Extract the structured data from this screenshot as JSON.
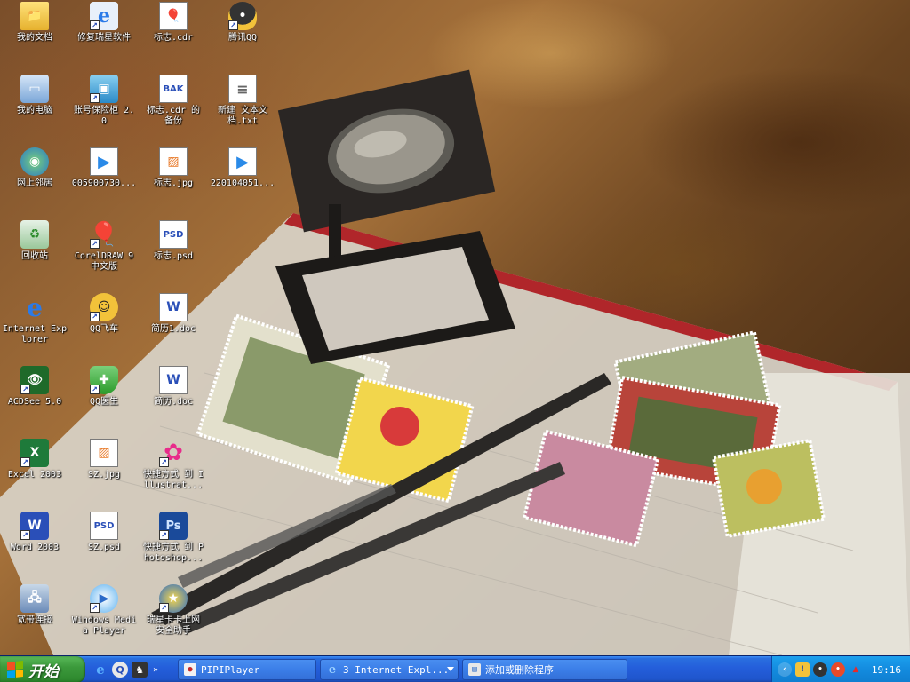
{
  "desktop": {
    "icons": [
      {
        "label": "我的文档",
        "icon": "my-documents-icon"
      },
      {
        "label": "修复瑞星软件",
        "icon": "ie-shortcut-icon"
      },
      {
        "label": "标志.cdr",
        "icon": "coreldraw-file-icon"
      },
      {
        "label": "腾讯QQ",
        "icon": "qq-penguin-icon"
      },
      {
        "label": "我的电脑",
        "icon": "my-computer-icon"
      },
      {
        "label": "账号保险柜 2.0",
        "icon": "account-safe-icon"
      },
      {
        "label": "标志.cdr 的 备份",
        "icon": "backup-file-icon"
      },
      {
        "label": "新建 文本文 档.txt",
        "icon": "text-file-icon"
      },
      {
        "label": "网上邻居",
        "icon": "network-places-icon"
      },
      {
        "label": "005900730...",
        "icon": "media-file-icon"
      },
      {
        "label": "标志.jpg",
        "icon": "jpg-file-icon"
      },
      {
        "label": "220104051...",
        "icon": "media-file-icon"
      },
      {
        "label": "回收站",
        "icon": "recycle-bin-icon"
      },
      {
        "label": "CorelDRAW 9 中文版",
        "icon": "coreldraw-balloon-icon"
      },
      {
        "label": "标志.psd",
        "icon": "psd-file-icon"
      },
      {
        "label": "Internet Explorer",
        "icon": "internet-explorer-icon"
      },
      {
        "label": "QQ飞车",
        "icon": "qq-speed-icon"
      },
      {
        "label": "简历1.doc",
        "icon": "word-doc-icon"
      },
      {
        "label": "ACDSee 5.0",
        "icon": "acdsee-icon"
      },
      {
        "label": "QQ医生",
        "icon": "qq-doctor-icon"
      },
      {
        "label": "简历.doc",
        "icon": "word-doc-icon"
      },
      {
        "label": "Excel 2003",
        "icon": "excel-icon"
      },
      {
        "label": "SZ.jpg",
        "icon": "jpg-file-icon"
      },
      {
        "label": "快捷方式 到 Illustrat...",
        "icon": "illustrator-icon"
      },
      {
        "label": "Word 2003",
        "icon": "word-icon"
      },
      {
        "label": "SZ.psd",
        "icon": "psd-file-icon"
      },
      {
        "label": "快捷方式 到 Photoshop...",
        "icon": "photoshop-icon"
      },
      {
        "label": "宽带连接",
        "icon": "broadband-connection-icon"
      },
      {
        "label": "Windows Media Player",
        "icon": "windows-media-player-icon"
      },
      {
        "label": "瑞星卡卡上网 安全助手",
        "icon": "rising-kaka-icon"
      }
    ]
  },
  "taskbar": {
    "start_label": "开始",
    "quick_launch": [
      {
        "icon": "ie-quicklaunch-icon",
        "glyph": "e"
      },
      {
        "icon": "qq-quicklaunch-icon",
        "glyph": "Q"
      },
      {
        "icon": "game-quicklaunch-icon",
        "glyph": "♞"
      }
    ],
    "quick_launch_more": "»",
    "tasks": [
      {
        "label": "PIPIPlayer",
        "icon": "pipiplayer-icon"
      },
      {
        "label": "3 Internet Expl...",
        "icon": "ie-group-icon"
      },
      {
        "label": "添加或删除程序",
        "icon": "add-remove-programs-icon"
      }
    ],
    "tray": {
      "clock": "19:16",
      "arrow": "‹"
    }
  },
  "colors": {
    "taskbar_blue": "#245edb",
    "start_green": "#3c9a3c",
    "tray_blue": "#138bdf"
  }
}
